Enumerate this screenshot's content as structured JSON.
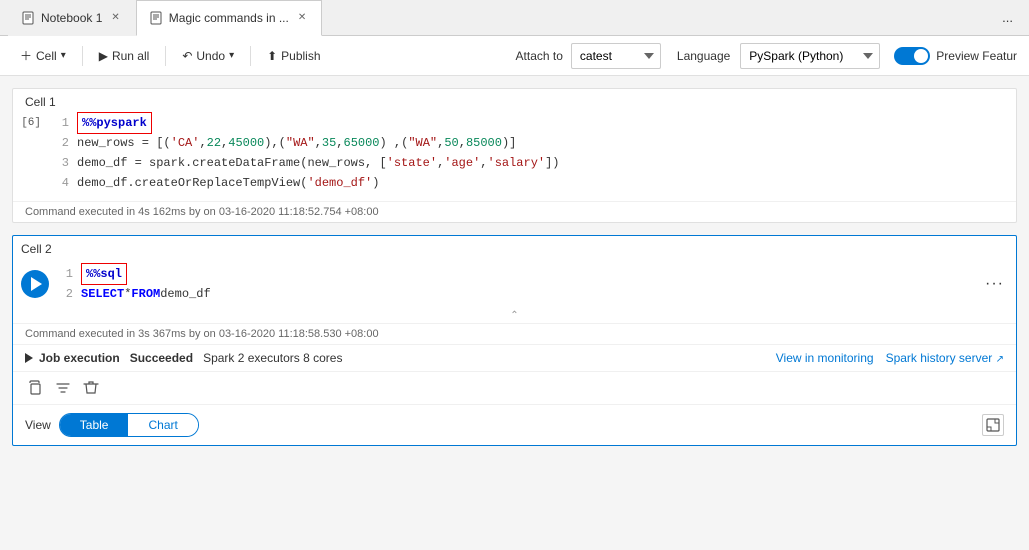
{
  "tabs": [
    {
      "id": "notebook1",
      "icon": "notebook-icon",
      "label": "Notebook 1",
      "active": false
    },
    {
      "id": "magic-commands",
      "icon": "notebook-icon",
      "label": "Magic commands in ...",
      "active": true
    }
  ],
  "tab_more": "...",
  "toolbar": {
    "cell_label": "Cell",
    "run_all_label": "Run all",
    "undo_label": "Undo",
    "publish_label": "Publish",
    "attach_label": "Attach to",
    "attach_value": "catest",
    "language_label": "Language",
    "language_value": "PySpark (Python)",
    "preview_label": "Preview Featur"
  },
  "cell1": {
    "label": "Cell 1",
    "exec_indicator": "[6]",
    "lines": [
      {
        "num": "1",
        "content": "%%pyspark",
        "type": "magic"
      },
      {
        "num": "2",
        "content": "new_rows = [('CA',22, 45000),('WA',35,65000) ,('WA',50,85000)]",
        "type": "code"
      },
      {
        "num": "3",
        "content": "demo_df = spark.createDataFrame(new_rows, ['state', 'age', 'salary'])",
        "type": "code"
      },
      {
        "num": "4",
        "content": "demo_df.createOrReplaceTempView('demo_df')",
        "type": "code"
      }
    ],
    "footer": "Command executed in 4s 162ms by    on 03-16-2020 11:18:52.754 +08:00"
  },
  "cell2": {
    "label": "Cell 2",
    "lines": [
      {
        "num": "1",
        "content": "%%sql",
        "type": "magic"
      },
      {
        "num": "2",
        "content": "SELECT * FROM demo_df",
        "type": "sql"
      }
    ],
    "footer": "Command executed in 3s 367ms by    on 03-16-2020 11:18:58.530 +08:00",
    "job": {
      "status": "Succeeded",
      "text": "Job execution",
      "spark_info": "Spark 2 executors 8 cores",
      "view_monitoring": "View in monitoring",
      "spark_history": "Spark history server"
    }
  },
  "view": {
    "label": "View",
    "table_label": "Table",
    "chart_label": "Chart"
  }
}
